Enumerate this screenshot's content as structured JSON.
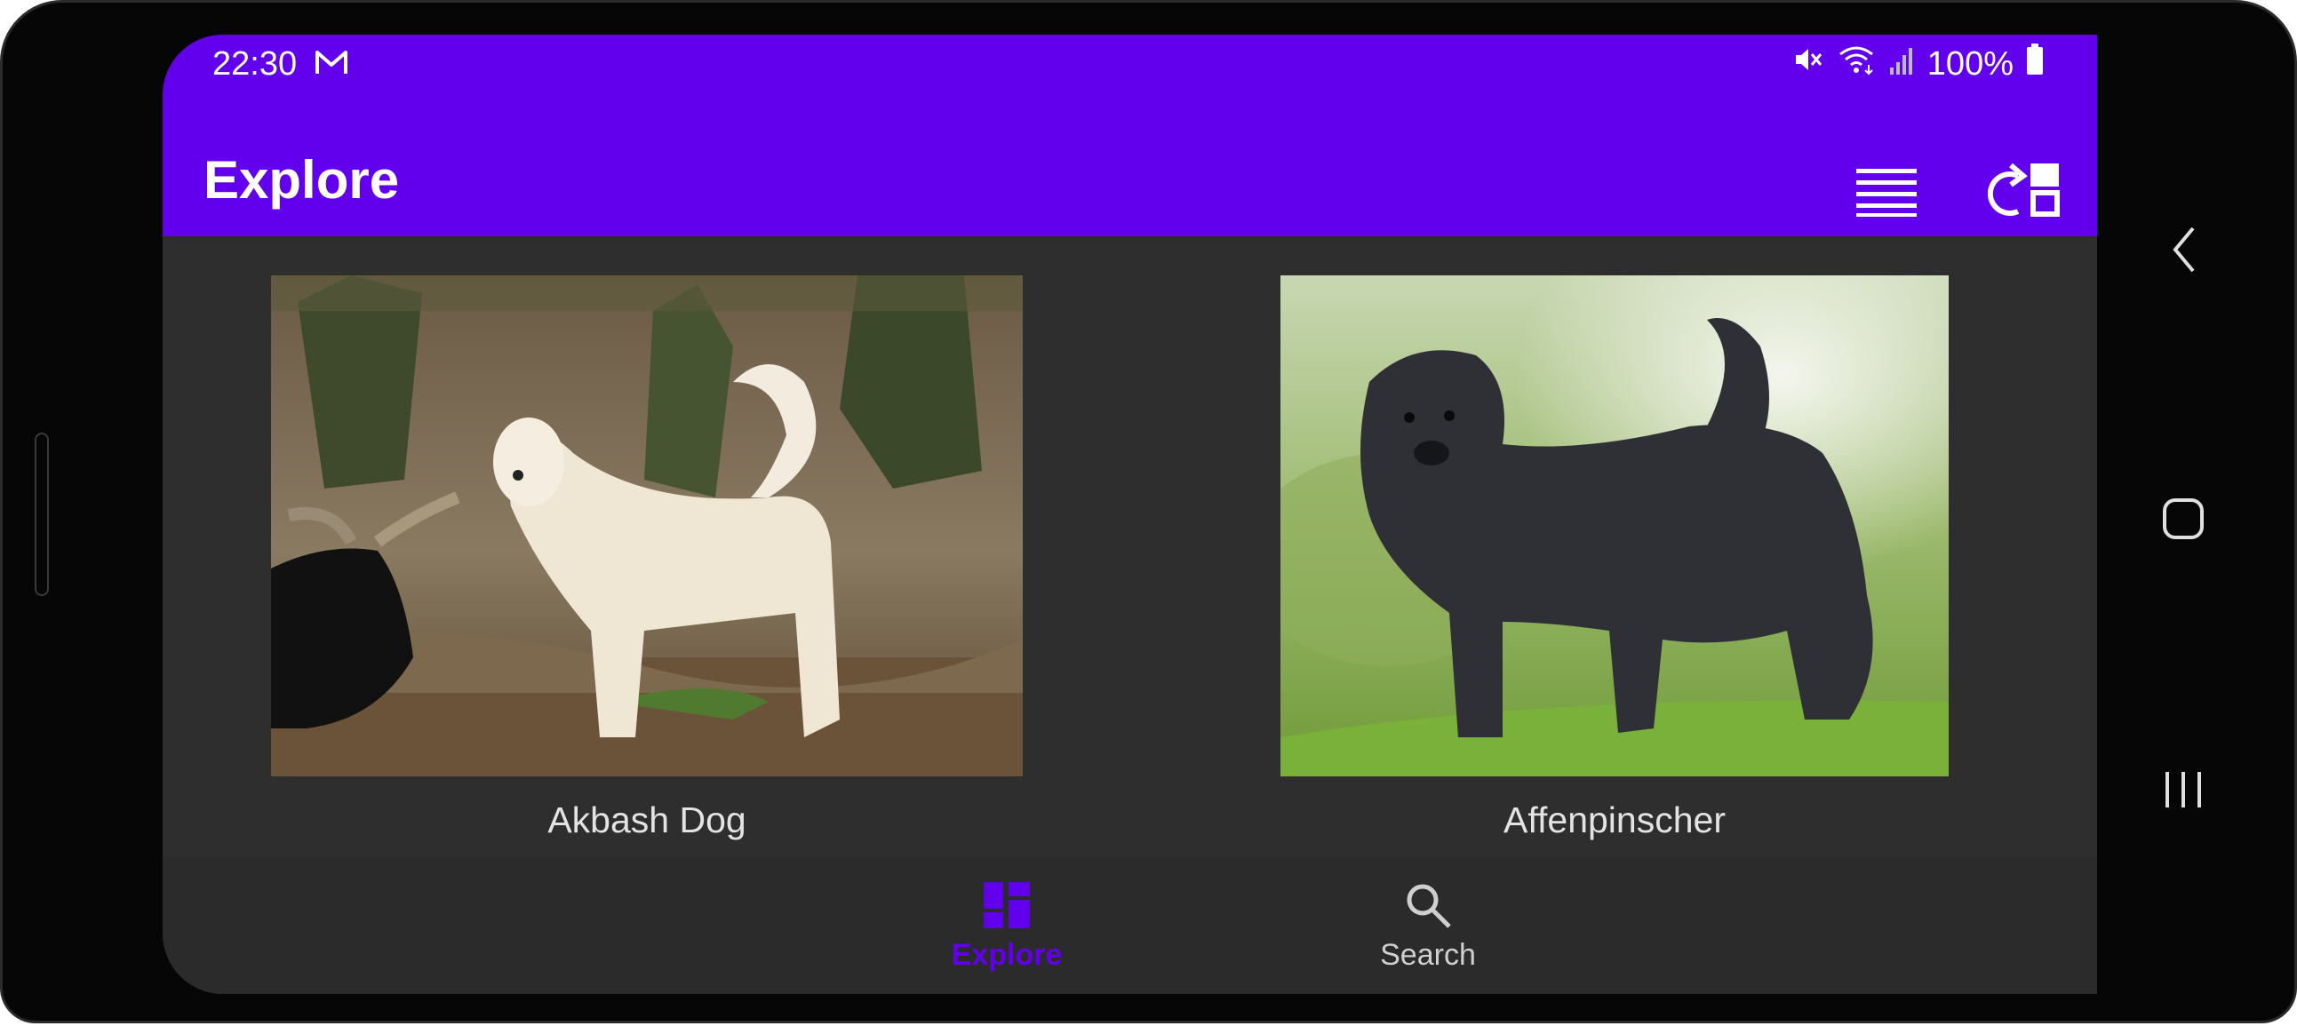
{
  "status_bar": {
    "time": "22:30",
    "mail_icon": "gmail-icon",
    "battery": "100%",
    "icons": [
      "mute-icon",
      "wifi-icon",
      "signal-icon",
      "battery-icon"
    ]
  },
  "app_bar": {
    "title": "Explore",
    "actions": [
      "list-view-icon",
      "switch-layout-icon"
    ]
  },
  "cards": [
    {
      "label": "Akbash Dog",
      "image": "white-dog-photo"
    },
    {
      "label": "Affenpinscher",
      "image": "black-dog-photo"
    }
  ],
  "bottom_nav": {
    "items": [
      {
        "label": "Explore",
        "icon": "grid-icon",
        "active": true
      },
      {
        "label": "Search",
        "icon": "search-icon",
        "active": false
      }
    ]
  },
  "colors": {
    "primary": "#6200ee",
    "background": "#2e2e2e",
    "nav_background": "#2b2b2b",
    "label_text": "#e3e3e3"
  },
  "system_nav": [
    "back-icon",
    "home-icon",
    "recents-icon"
  ]
}
